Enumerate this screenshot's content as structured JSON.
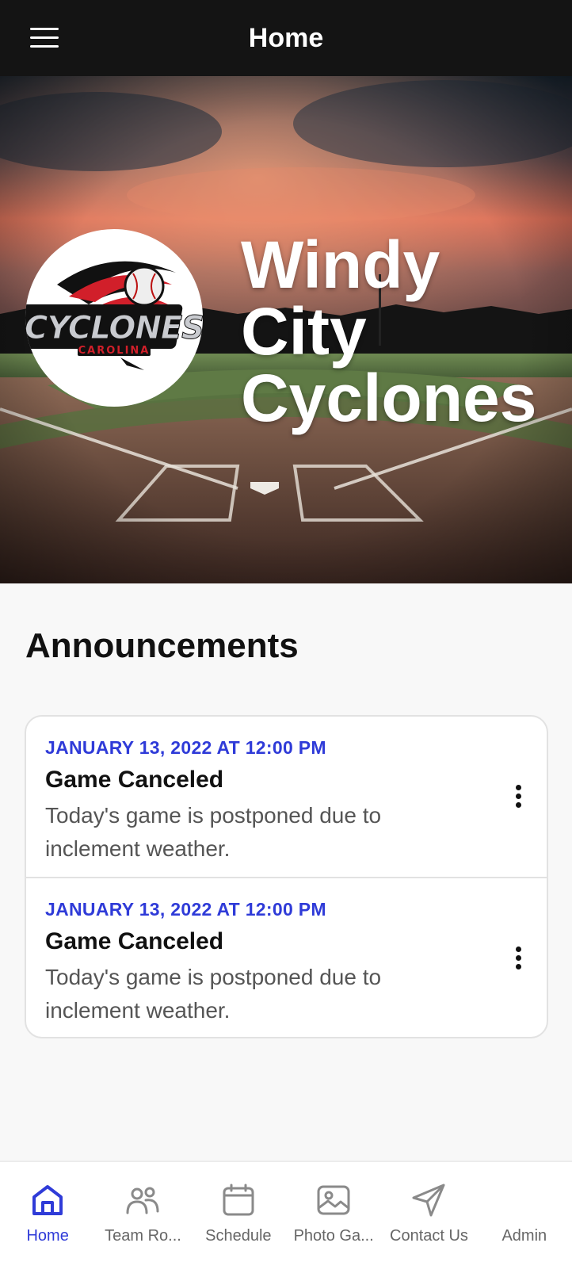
{
  "header": {
    "title": "Home",
    "menu_icon": "hamburger-menu-icon"
  },
  "hero": {
    "team_name_lines": [
      "Windy",
      "City",
      "Cyclones"
    ],
    "logo": {
      "word": "CYCLONES",
      "subword": "CAROLINA",
      "colors": {
        "red": "#d11f2a",
        "black": "#111111",
        "silver": "#c9cbd0"
      }
    }
  },
  "announcements": {
    "title": "Announcements",
    "items": [
      {
        "date": "JANUARY 13, 2022 AT 12:00 PM",
        "title": "Game Canceled",
        "body": "Today's game is postponed due to inclement weather."
      },
      {
        "date": "JANUARY 13, 2022 AT 12:00 PM",
        "title": "Game Canceled",
        "body": "Today's game is postponed due to inclement weather."
      }
    ]
  },
  "tabbar": {
    "tabs": [
      {
        "label": "Home",
        "icon": "home-icon",
        "active": true
      },
      {
        "label": "Team Ro...",
        "icon": "team-icon",
        "active": false
      },
      {
        "label": "Schedule",
        "icon": "calendar-icon",
        "active": false
      },
      {
        "label": "Photo Ga...",
        "icon": "photo-icon",
        "active": false
      },
      {
        "label": "Contact Us",
        "icon": "send-icon",
        "active": false
      },
      {
        "label": "Admin",
        "icon": "",
        "active": false
      }
    ]
  },
  "colors": {
    "accent": "#2f3bd8",
    "topbar": "#141414",
    "inactive_icon": "#8a8a8a"
  }
}
